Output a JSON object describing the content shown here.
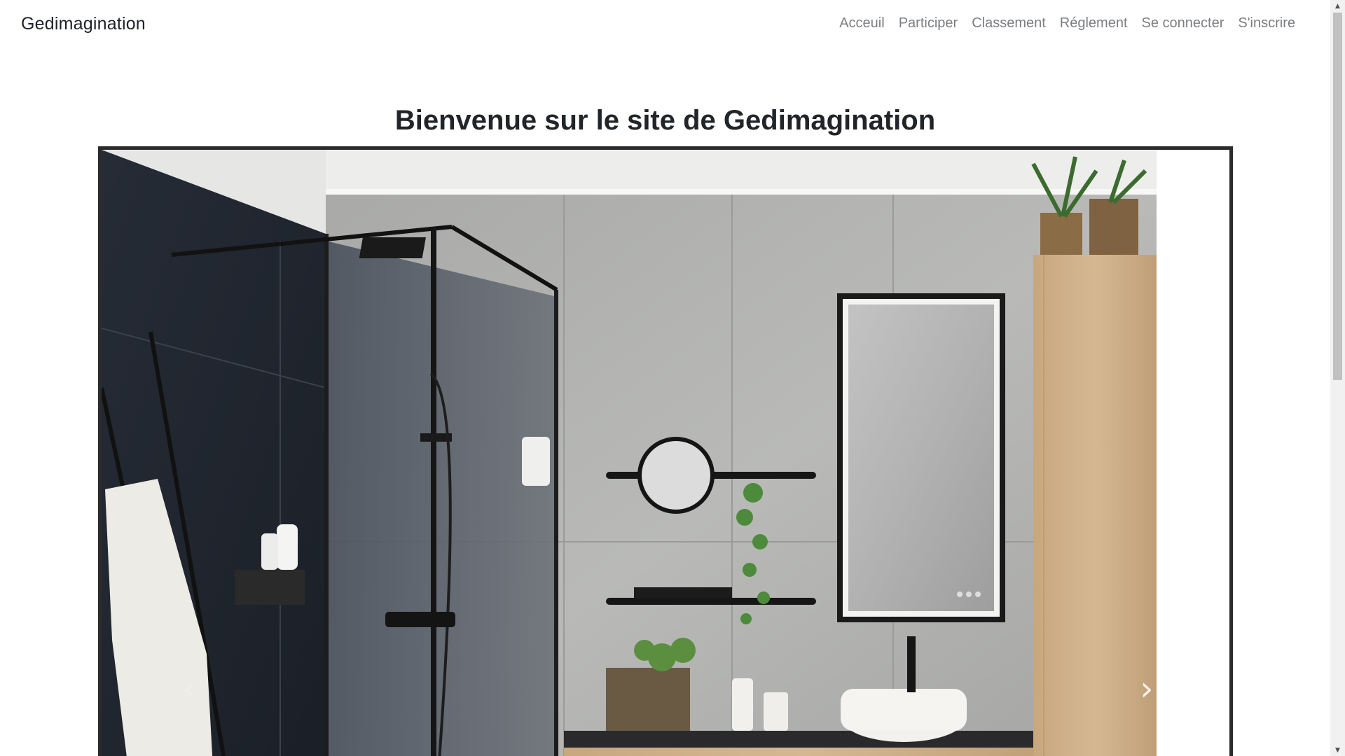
{
  "navbar": {
    "brand": "Gedimagination",
    "links": [
      {
        "label": "Acceuil"
      },
      {
        "label": "Participer"
      },
      {
        "label": "Classement"
      },
      {
        "label": "Réglement"
      },
      {
        "label": "Se connecter"
      },
      {
        "label": "S'inscrire"
      }
    ]
  },
  "main": {
    "title": "Bienvenue sur le site de Gedimagination"
  },
  "carousel": {
    "prev_icon": "chevron-left-icon",
    "next_icon": "chevron-right-icon",
    "slide_subject": "bathroom-photo"
  },
  "colors": {
    "nav_link": "#7b7e82",
    "brand": "#1f2328",
    "carousel_border": "#2b2b2b"
  }
}
